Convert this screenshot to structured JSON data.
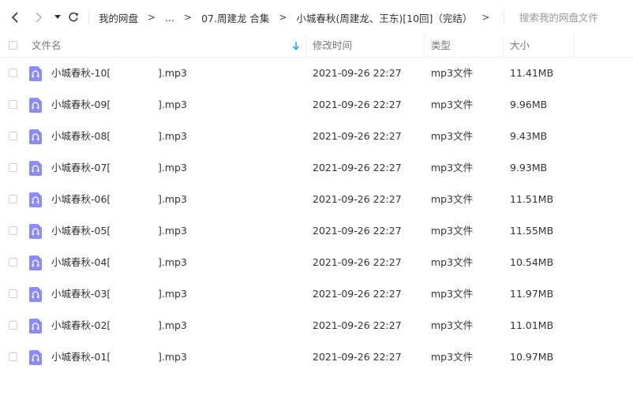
{
  "toolbar": {
    "back_icon": "chevron-left-icon",
    "forward_icon": "chevron-right-icon",
    "dropdown_icon": "caret-down-icon",
    "refresh_icon": "refresh-icon",
    "search_placeholder": "搜索我的网盘文件"
  },
  "breadcrumb": {
    "items": [
      "我的网盘",
      "...",
      "07.周建龙 合集",
      "小城春秋(周建龙、王东)[10回]（完结）"
    ],
    "separator": ">"
  },
  "columns": {
    "name": "文件名",
    "modified": "修改时间",
    "type": "类型",
    "size": "大小"
  },
  "sort": {
    "column": "name",
    "icon": "sort-down-arrow-icon"
  },
  "colors": {
    "accent": "#1a9cf0",
    "file_icon": "#8b8cf6",
    "text": "#333333",
    "header_text": "#777777"
  },
  "files": [
    {
      "name_prefix": "小城春秋-10[",
      "name_suffix": "].mp3",
      "modified": "2021-09-26 22:27",
      "type": "mp3文件",
      "size": "11.41MB",
      "icon": "audio-file-icon"
    },
    {
      "name_prefix": "小城春秋-09[",
      "name_suffix": "].mp3",
      "modified": "2021-09-26 22:27",
      "type": "mp3文件",
      "size": "9.96MB",
      "icon": "audio-file-icon"
    },
    {
      "name_prefix": "小城春秋-08[",
      "name_suffix": "].mp3",
      "modified": "2021-09-26 22:27",
      "type": "mp3文件",
      "size": "9.43MB",
      "icon": "audio-file-icon"
    },
    {
      "name_prefix": "小城春秋-07[",
      "name_suffix": "].mp3",
      "modified": "2021-09-26 22:27",
      "type": "mp3文件",
      "size": "9.93MB",
      "icon": "audio-file-icon"
    },
    {
      "name_prefix": "小城春秋-06[",
      "name_suffix": "].mp3",
      "modified": "2021-09-26 22:27",
      "type": "mp3文件",
      "size": "11.51MB",
      "icon": "audio-file-icon"
    },
    {
      "name_prefix": "小城春秋-05[",
      "name_suffix": "].mp3",
      "modified": "2021-09-26 22:27",
      "type": "mp3文件",
      "size": "11.55MB",
      "icon": "audio-file-icon"
    },
    {
      "name_prefix": "小城春秋-04[",
      "name_suffix": "].mp3",
      "modified": "2021-09-26 22:27",
      "type": "mp3文件",
      "size": "10.54MB",
      "icon": "audio-file-icon"
    },
    {
      "name_prefix": "小城春秋-03[",
      "name_suffix": "].mp3",
      "modified": "2021-09-26 22:27",
      "type": "mp3文件",
      "size": "11.97MB",
      "icon": "audio-file-icon"
    },
    {
      "name_prefix": "小城春秋-02[",
      "name_suffix": "].mp3",
      "modified": "2021-09-26 22:27",
      "type": "mp3文件",
      "size": "11.01MB",
      "icon": "audio-file-icon"
    },
    {
      "name_prefix": "小城春秋-01[",
      "name_suffix": "].mp3",
      "modified": "2021-09-26 22:27",
      "type": "mp3文件",
      "size": "10.97MB",
      "icon": "audio-file-icon"
    }
  ]
}
